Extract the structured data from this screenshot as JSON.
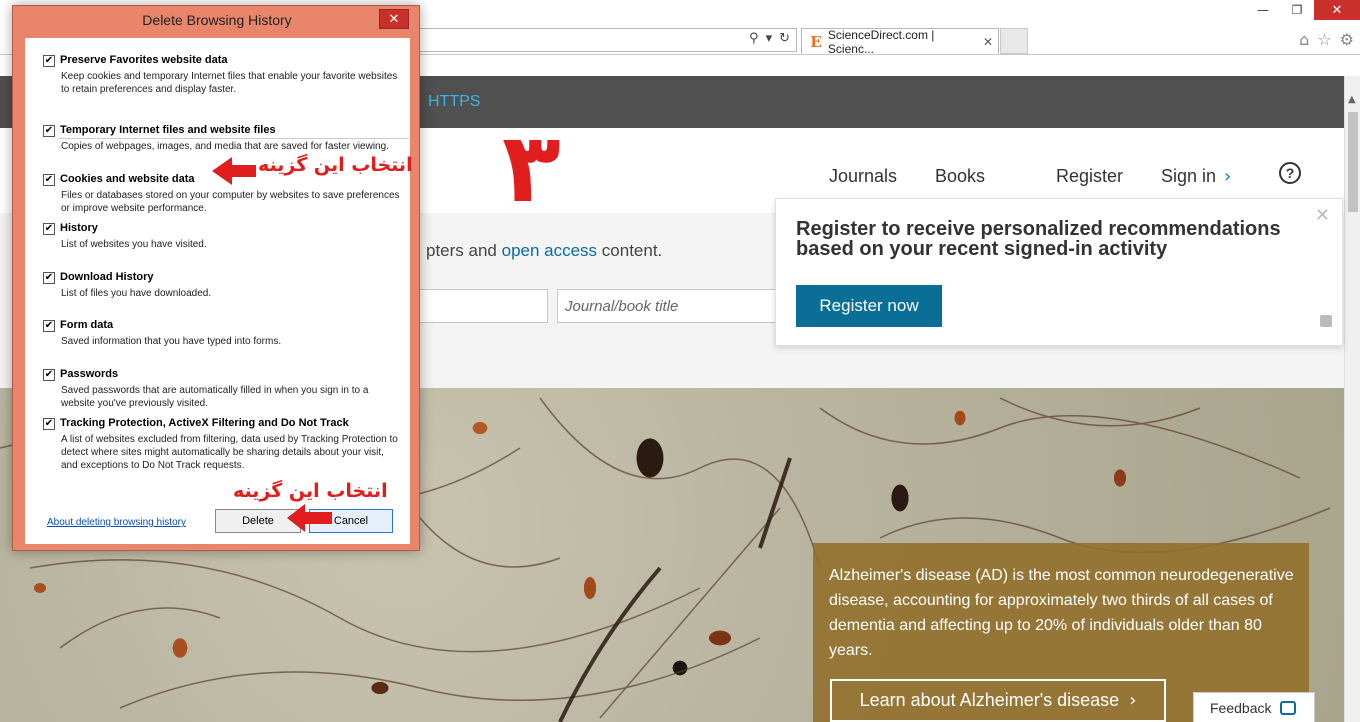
{
  "browser": {
    "tab_title": "ScienceDirect.com | Scienc...",
    "tab_favicon": "E",
    "close_symbol": "✕",
    "minimize_symbol": "—",
    "restore_symbol": "❐"
  },
  "page": {
    "https_text": "HTTPS",
    "nav": {
      "journals": "Journals",
      "books": "Books",
      "register": "Register",
      "signin": "Sign in"
    },
    "content_text_before": "pters and ",
    "content_text_link": "open access",
    "content_text_after": " content.",
    "journal_placeholder": "Journal/book title",
    "popup": {
      "title": "Register to receive personalized recommendations based on your recent signed-in activity",
      "button": "Register now"
    },
    "hero": {
      "text": "Alzheimer's disease (AD) is the most common neurodegenerative disease, accounting for approximately two thirds of all cases of dementia and affecting up to 20% of individuals older than 80 years.",
      "button": "Learn about Alzheimer's disease"
    },
    "feedback": "Feedback"
  },
  "dialog": {
    "title": "Delete Browsing History",
    "options": [
      {
        "label": "Preserve Favorites website data",
        "desc": "Keep cookies and temporary Internet files that enable your favorite websites to retain preferences and display faster.",
        "checked": true
      },
      {
        "label": "Temporary Internet files and website files",
        "desc": "Copies of webpages, images, and media that are saved for faster viewing.",
        "checked": true
      },
      {
        "label": "Cookies and website data",
        "desc": "Files or databases stored on your computer by websites to save preferences or improve website performance.",
        "checked": true
      },
      {
        "label": "History",
        "desc": "List of websites you have visited.",
        "checked": true
      },
      {
        "label": "Download History",
        "desc": "List of files you have downloaded.",
        "checked": true
      },
      {
        "label": "Form data",
        "desc": "Saved information that you have typed into forms.",
        "checked": true
      },
      {
        "label": "Passwords",
        "desc": "Saved passwords that are automatically filled in when you sign in to a website you've previously visited.",
        "checked": true
      },
      {
        "label": "Tracking Protection, ActiveX Filtering and Do Not Track",
        "desc": "A list of websites excluded from filtering, data used by Tracking Protection to detect where sites might automatically be sharing details about your visit, and exceptions to Do Not Track requests.",
        "checked": true
      }
    ],
    "help_link": "About deleting browsing history",
    "delete_btn": "Delete",
    "cancel_btn": "Cancel"
  },
  "annotations": {
    "select_option_1": "انتخاب این گزینه",
    "select_option_2": "انتخاب این گزینه",
    "step_number": "۳",
    "color": "#e01e1e"
  }
}
